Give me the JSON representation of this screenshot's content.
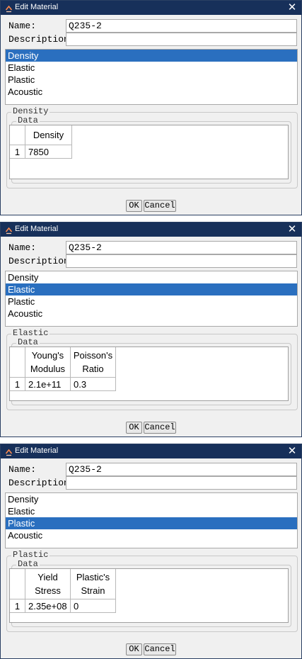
{
  "dialogs": [
    {
      "title": "Edit Material",
      "name_label": "Name:",
      "name_value": "Q235-2",
      "description_label": "Description:",
      "description_value": "",
      "list": [
        "Density",
        "Elastic",
        "Plastic",
        "Acoustic"
      ],
      "selected": "Density",
      "group_title": "Density",
      "data_title": "Data",
      "columns": [
        [
          "Density"
        ]
      ],
      "row_number": "1",
      "row_values": [
        "7850"
      ],
      "ok": "OK",
      "cancel": "Cancel"
    },
    {
      "title": "Edit Material",
      "name_label": "Name:",
      "name_value": "Q235-2",
      "description_label": "Description:",
      "description_value": "",
      "list": [
        "Density",
        "Elastic",
        "Plastic",
        "Acoustic"
      ],
      "selected": "Elastic",
      "group_title": "Elastic",
      "data_title": "Data",
      "columns": [
        [
          "Young's",
          "Modulus"
        ],
        [
          "Poisson's",
          "Ratio"
        ]
      ],
      "row_number": "1",
      "row_values": [
        "2.1e+11",
        "0.3"
      ],
      "ok": "OK",
      "cancel": "Cancel"
    },
    {
      "title": "Edit Material",
      "name_label": "Name:",
      "name_value": "Q235-2",
      "description_label": "Description:",
      "description_value": "",
      "list": [
        "Density",
        "Elastic",
        "Plastic",
        "Acoustic"
      ],
      "selected": "Plastic",
      "group_title": "Plastic",
      "data_title": "Data",
      "columns": [
        [
          "Yield",
          "Stress"
        ],
        [
          "Plastic's",
          "Strain"
        ]
      ],
      "row_number": "1",
      "row_values": [
        "2.35e+08",
        "0"
      ],
      "ok": "OK",
      "cancel": "Cancel"
    }
  ],
  "icons": {
    "app": "material-app-icon",
    "close": "close-icon"
  },
  "colors": {
    "titlebar": "#17305a",
    "selection": "#2a6fbf",
    "window_bg": "#f0f0f0"
  }
}
